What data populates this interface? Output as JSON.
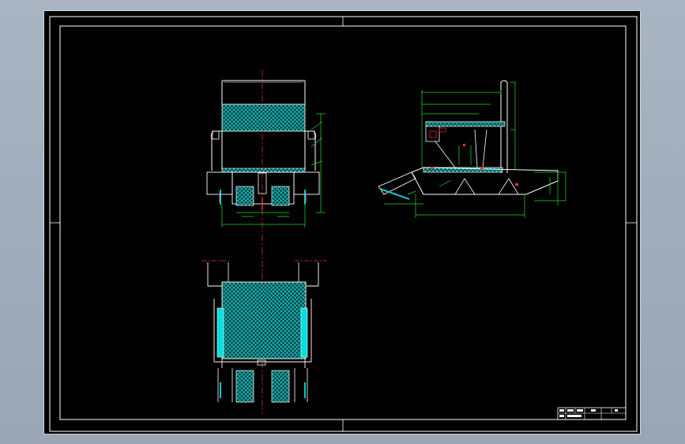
{
  "colors": {
    "background": "#000000",
    "frame": "#ffffff",
    "outline": "#ffffff",
    "hatch": "#19c7c7",
    "dimension": "#22dd22",
    "centerline": "#ff3030",
    "highlight": "#00ffff"
  },
  "views": {
    "front": "front-view",
    "side": "side-view",
    "top": "top-view"
  },
  "title_block": {
    "drawing_name": "",
    "scale": "",
    "sheet": ""
  }
}
